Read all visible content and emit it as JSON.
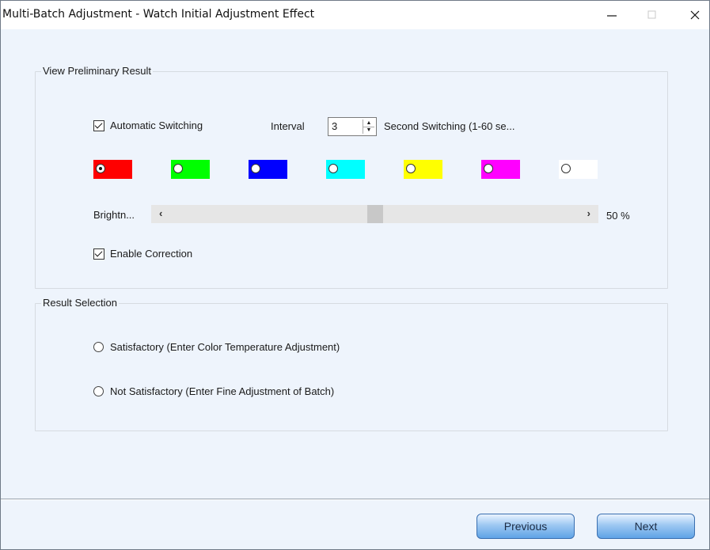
{
  "window": {
    "title": "Multi-Batch Adjustment - Watch Initial Adjustment Effect",
    "minimize_glyph": "—",
    "maximize_glyph": "☐",
    "close_glyph": "✕"
  },
  "preview_group": {
    "label": "View Preliminary Result",
    "auto_switch_label": "Automatic Switching",
    "auto_switch_checked": true,
    "interval_label": "Interval",
    "interval_value": "3",
    "interval_suffix": "Second Switching (1-60 se...",
    "colors": [
      {
        "name": "red",
        "hex": "#ff0000",
        "selected": true
      },
      {
        "name": "green",
        "hex": "#00ff00",
        "selected": false
      },
      {
        "name": "blue",
        "hex": "#0000ff",
        "selected": false
      },
      {
        "name": "cyan",
        "hex": "#00ffff",
        "selected": false
      },
      {
        "name": "yellow",
        "hex": "#ffff00",
        "selected": false
      },
      {
        "name": "magenta",
        "hex": "#ff00ff",
        "selected": false
      },
      {
        "name": "white",
        "hex": "#ffffff",
        "selected": false
      }
    ],
    "brightness_label": "Brightn...",
    "brightness_value": 50,
    "brightness_text": "50 %",
    "enable_correction_label": "Enable Correction",
    "enable_correction_checked": true
  },
  "result_group": {
    "label": "Result Selection",
    "options": [
      {
        "label": "Satisfactory (Enter Color Temperature Adjustment)",
        "selected": false
      },
      {
        "label": "Not Satisfactory (Enter Fine Adjustment of Batch)",
        "selected": false
      }
    ]
  },
  "footer": {
    "previous_label": "Previous",
    "next_label": "Next"
  }
}
